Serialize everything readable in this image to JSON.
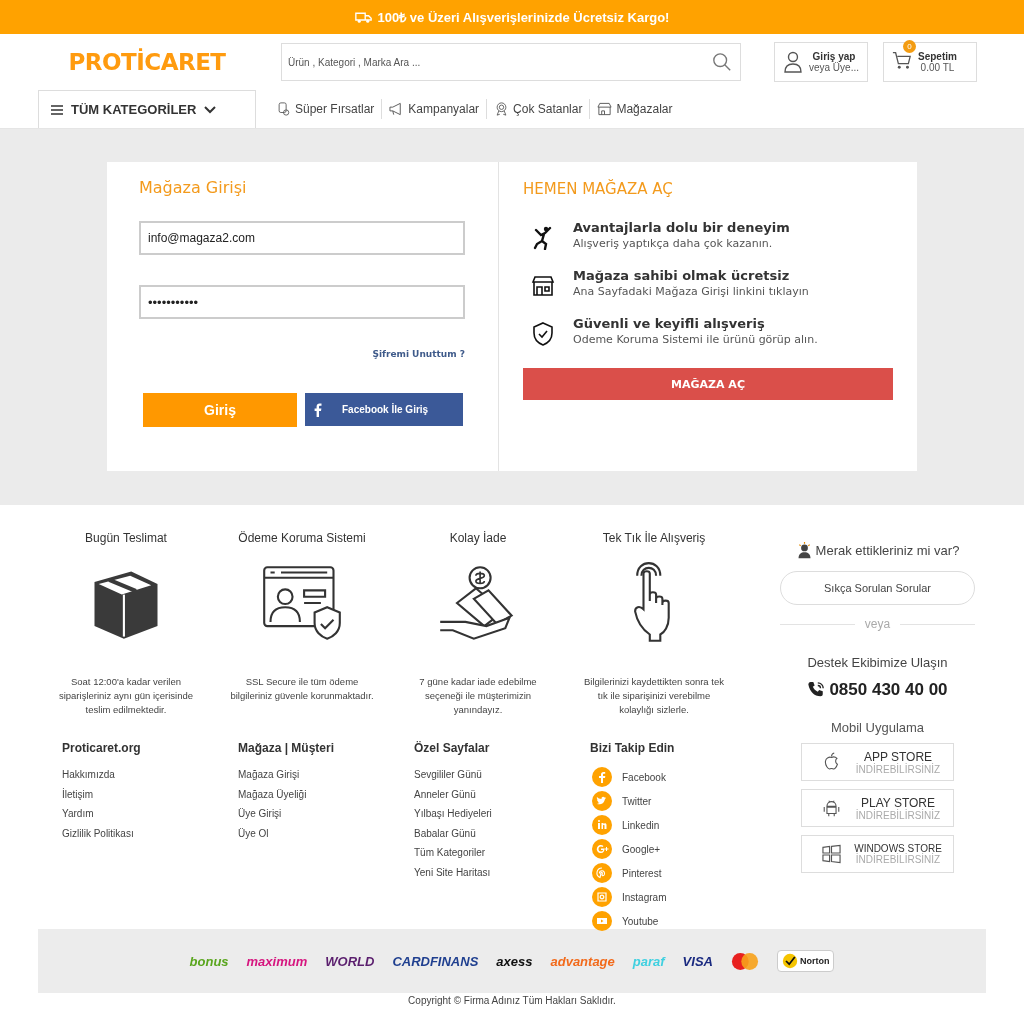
{
  "promo_bar": {
    "text": "100₺ ve Üzeri Alışverişlerinizde Ücretsiz Kargo!"
  },
  "header": {
    "logo": "PROTİCARET",
    "search": {
      "placeholder": "Ürün , Kategori , Marka Ara ..."
    },
    "account": {
      "title": "Giriş yap",
      "subtitle": "veya Üye..."
    },
    "cart": {
      "count": "0",
      "title": "Sepetim",
      "total": "0.00 TL"
    }
  },
  "nav": {
    "categories": "TÜM KATEGORİLER",
    "links": [
      {
        "label": "Süper Fırsatlar",
        "kind": "tag"
      },
      {
        "label": "Kampanyalar",
        "kind": "megaphone"
      },
      {
        "label": "Çok Satanlar",
        "kind": "medal"
      },
      {
        "label": "Mağazalar",
        "kind": "store"
      }
    ]
  },
  "login": {
    "title": "Mağaza Girişi",
    "email": "info@magaza2.com",
    "password": "•••••••••••",
    "forgot": "Şifremi Unuttum ?",
    "submit": "Giriş",
    "facebook": "Facebook İle Giriş"
  },
  "open_store": {
    "title": "HEMEN MAĞAZA AÇ",
    "benefits": [
      {
        "kind": "jump",
        "title": "Avantajlarla dolu bir deneyim",
        "text": "Alışveriş yaptıkça daha çok kazanın."
      },
      {
        "kind": "store",
        "title": "Mağaza sahibi olmak ücretsiz",
        "text": "Ana Sayfadaki Mağaza Girişi linkini tıklayın"
      },
      {
        "kind": "shield",
        "title": "Güvenli ve keyifli alışveriş",
        "text": "Odeme Koruma Sistemi ile ürünü görüp alın."
      }
    ],
    "button": "MAĞAZA AÇ"
  },
  "features": [
    {
      "kind": "box",
      "title": "Bugün Teslimat",
      "text": "Soat 12:00'a kadar verilen siparişleriniz aynı gün içerisinde teslim edilmektedir."
    },
    {
      "kind": "secure",
      "title": "Ödeme Koruma Sistemi",
      "text": "SSL Secure ile tüm ödeme bilgileriniz güvenle korunmaktadır."
    },
    {
      "kind": "money",
      "title": "Kolay İade",
      "text": "7 güne kadar iade edebilme seçeneği ile müşterimizin yanındayız."
    },
    {
      "kind": "hand",
      "title": "Tek Tık İle Alışveriş",
      "text": "Bilgilerinizi kaydettikten sonra tek tık ile siparişinizi verebilme kolaylığı sizlerle."
    }
  ],
  "link_columns": [
    {
      "title": "Proticaret.org",
      "links": [
        "Hakkımızda",
        "İletişim",
        "Yardım",
        "Gizlilik Politikası"
      ]
    },
    {
      "title": "Mağaza | Müşteri",
      "links": [
        "Mağaza Girişi",
        "Mağaza Üyeliği",
        "Üye Girişi",
        "Üye Ol"
      ]
    },
    {
      "title": "Özel Sayfalar",
      "links": [
        "Sevgililer Günü",
        "Anneler Günü",
        "Yılbaşı Hediyeleri",
        "Babalar Günü",
        "Tüm Kategoriler",
        "Yeni Site Haritası"
      ]
    }
  ],
  "social": {
    "title": "Bizi Takip Edin",
    "links": [
      {
        "kind": "facebook",
        "label": "Facebook"
      },
      {
        "kind": "twitter",
        "label": "Twitter"
      },
      {
        "kind": "linkedin",
        "label": "Linkedin"
      },
      {
        "kind": "google",
        "label": "Google+"
      },
      {
        "kind": "pinterest",
        "label": "Pinterest"
      },
      {
        "kind": "instagram",
        "label": "Instagram"
      },
      {
        "kind": "youtube",
        "label": "Youtube"
      }
    ]
  },
  "help": {
    "question": "Merak ettikleriniz mi var?",
    "faq": "Sıkça Sorulan Sorular",
    "or": "veya",
    "support": "Destek Ekibimize Ulaşın",
    "phone": "0850 430 40 00",
    "apps_title": "Mobil Uygulama",
    "apps": [
      {
        "kind": "apple",
        "name": "APP STORE",
        "action": "İNDİREBİLİRSİNİZ"
      },
      {
        "kind": "android",
        "name": "PLAY STORE",
        "action": "İNDİREBİLİRSİNİZ"
      },
      {
        "kind": "windows",
        "name": "WINDOWS STORE",
        "action": "İNDİREBİLİRSİNİZ"
      }
    ]
  },
  "payment_logos": [
    {
      "kind": "text",
      "label": "bonus",
      "color": "#5aa61e"
    },
    {
      "kind": "text",
      "label": "maximum",
      "color": "#d6167f"
    },
    {
      "kind": "text",
      "label": "WORLD",
      "color": "#5b1f6e"
    },
    {
      "kind": "text",
      "label": "CARDFINANS",
      "color": "#1f3f8f"
    },
    {
      "kind": "text",
      "label": "axess",
      "color": "#111111"
    },
    {
      "kind": "text",
      "label": "advantage",
      "color": "#f26a1b"
    },
    {
      "kind": "text",
      "label": "paraf",
      "color": "#3fd0e0"
    },
    {
      "kind": "text",
      "label": "VISA",
      "color": "#1a2a80"
    },
    {
      "kind": "mastercard",
      "color": "#e8201f"
    },
    {
      "kind": "norton",
      "label": "Norton",
      "color": "#f5c400"
    }
  ],
  "copyright": "Copyright © Firma Adınız Tüm Hakları Saklıdır."
}
